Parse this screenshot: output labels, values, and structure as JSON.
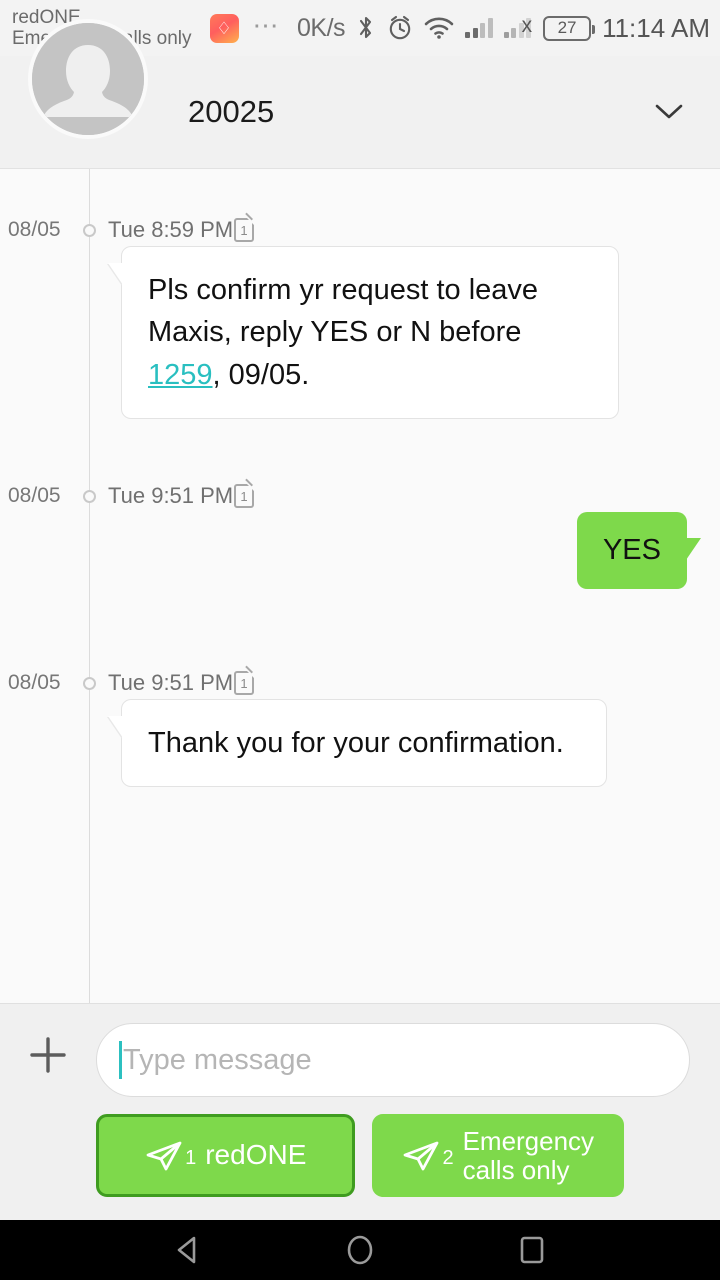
{
  "status_bar": {
    "carrier_line1": "redONE",
    "carrier_line2": "Emergency calls only",
    "app_badge_icon": "notification-app-icon",
    "overflow_icon": "more-notifications-icon",
    "network_speed": "0K/s",
    "bluetooth_icon": "bluetooth-icon",
    "alarm_icon": "alarm-clock-icon",
    "wifi_icon": "wifi-icon",
    "signal_sim1_icon": "signal-bars-icon",
    "signal_sim2_icon": "signal-bars-no-service-icon",
    "signal_sim2_mark": "x",
    "battery_level": "27",
    "clock": "11:14 AM"
  },
  "header": {
    "avatar_icon": "default-contact-avatar",
    "title": "20025",
    "expand_icon": "chevron-down-icon"
  },
  "conversation": {
    "messages": [
      {
        "date": "08/05",
        "time": "Tue 8:59 PM",
        "sim": "1",
        "direction": "incoming",
        "text_before_link": "Pls confirm yr request to leave Maxis, reply YES or N before ",
        "link_text": "1259",
        "text_after_link": ", 09/05."
      },
      {
        "date": "08/05",
        "time": "Tue 9:51 PM",
        "sim": "1",
        "direction": "outgoing",
        "text": "YES"
      },
      {
        "date": "08/05",
        "time": "Tue 9:51 PM",
        "sim": "1",
        "direction": "incoming",
        "text": "Thank you for your confirmation."
      }
    ]
  },
  "composer": {
    "attach_icon": "plus-icon",
    "placeholder": "Type message",
    "value": "",
    "send_buttons": [
      {
        "icon": "send-icon",
        "sim": "1",
        "label": "redONE",
        "focused": true
      },
      {
        "icon": "send-icon",
        "sim": "2",
        "label_line1": "Emergency",
        "label_line2": "calls only",
        "focused": false
      }
    ]
  },
  "nav_bar": {
    "back_icon": "back-triangle-icon",
    "home_icon": "home-circle-icon",
    "recents_icon": "recents-square-icon"
  },
  "colors": {
    "outgoing_bubble": "#7ed94b",
    "link": "#29bfc0",
    "caret": "#2cc0c0",
    "primary_button_border": "#3f9c20"
  }
}
